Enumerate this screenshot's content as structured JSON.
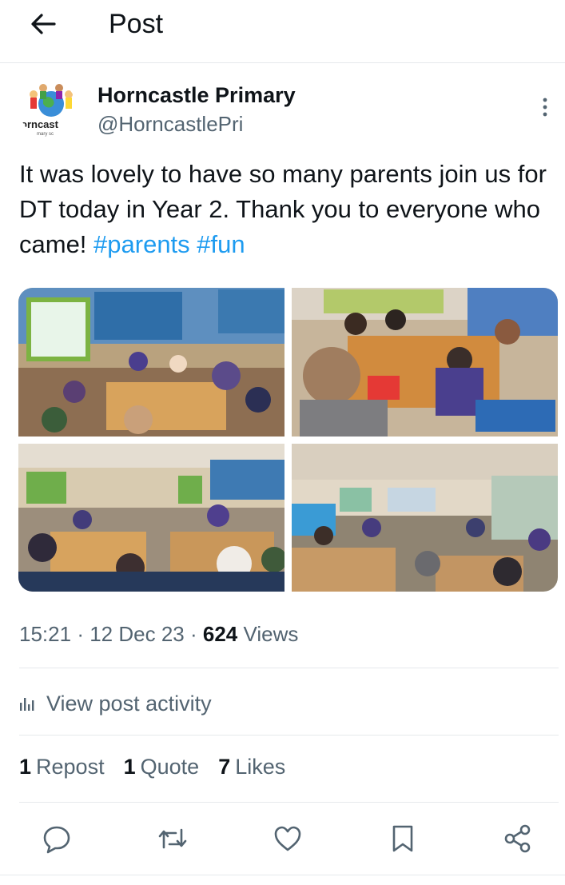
{
  "header": {
    "title": "Post",
    "back_icon": "arrow-left-icon"
  },
  "post": {
    "author_name": "Horncastle Primary",
    "author_handle": "@HorncastlePri",
    "avatar_text": "orncast",
    "text_main": "It was lovely to have so many parents join us for DT today in Year 2. Thank you to everyone who came! ",
    "hashtags": [
      "#parents",
      "#fun"
    ],
    "time": "15:21",
    "date": "12 Dec 23",
    "views_count": "624",
    "views_label": "Views",
    "dot": "·"
  },
  "activity": {
    "label": "View post activity",
    "icon": "bar-chart-icon"
  },
  "stats": {
    "reposts_count": "1",
    "reposts_label": "Repost",
    "quotes_count": "1",
    "quotes_label": "Quote",
    "likes_count": "7",
    "likes_label": "Likes"
  },
  "actions": [
    "reply-icon",
    "repost-icon",
    "like-icon",
    "bookmark-icon",
    "share-icon"
  ],
  "colors": {
    "link": "#1d9bf0",
    "secondary_text": "#536471",
    "divider": "#e6e9ec"
  }
}
